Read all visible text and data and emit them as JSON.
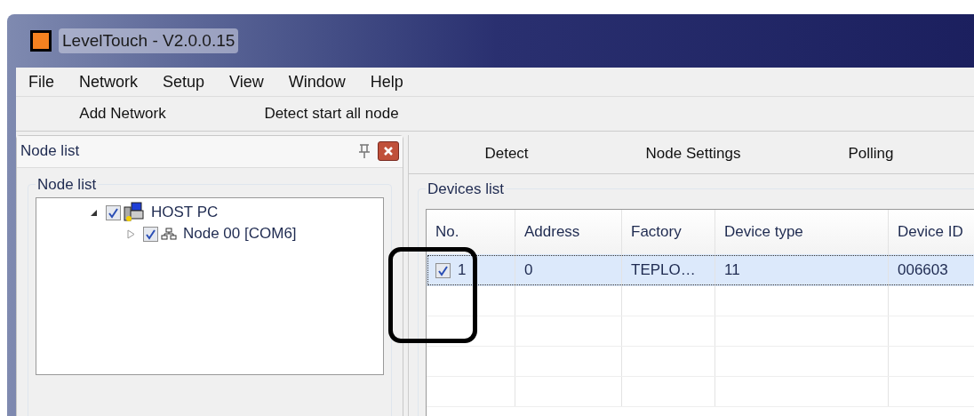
{
  "window": {
    "title": "LevelTouch - V2.0.0.15"
  },
  "menu": [
    "File",
    "Network",
    "Setup",
    "View",
    "Window",
    "Help"
  ],
  "toolbar": [
    "Add Network",
    "Detect start all node"
  ],
  "node_panel": {
    "title": "Node list",
    "group_title": "Node list",
    "tree": [
      {
        "label": "HOST PC",
        "checked": true,
        "expanded": true,
        "kind": "host",
        "children": [
          {
            "label": "Node 00 [COM6]",
            "checked": true,
            "expanded": false,
            "kind": "node"
          }
        ]
      }
    ]
  },
  "tabs": [
    "Detect",
    "Node Settings",
    "Polling"
  ],
  "devices": {
    "title": "Devices list",
    "columns": [
      "No.",
      "Address",
      "Factory",
      "Device type",
      "Device ID"
    ],
    "rows": [
      {
        "checked": true,
        "selected": true,
        "cells": [
          "1",
          "0",
          "TEPLO…",
          "11",
          "006603"
        ]
      }
    ]
  }
}
